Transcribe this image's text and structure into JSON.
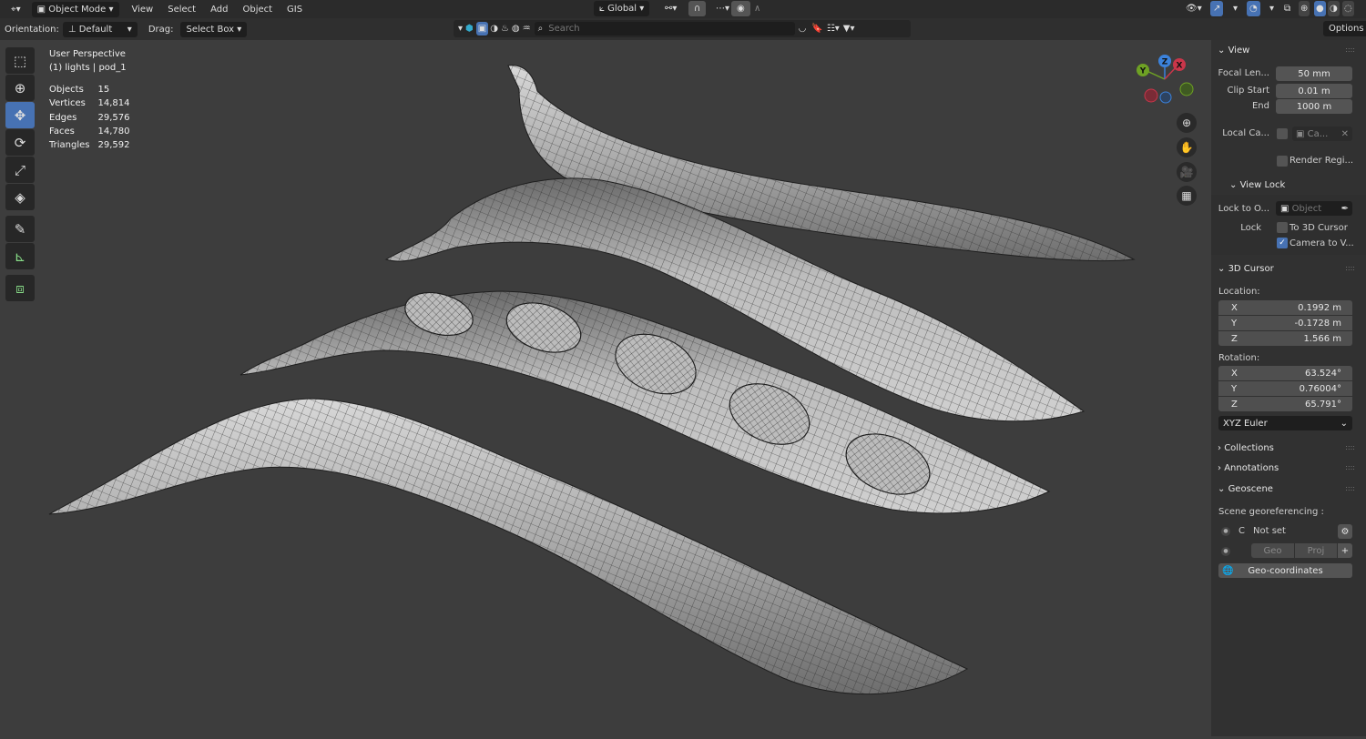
{
  "header": {
    "editor_icon": "editor-type-icon",
    "mode": "Object Mode",
    "menus": [
      "View",
      "Select",
      "Add",
      "Object",
      "GIS"
    ],
    "transform_orientation": "Global",
    "right_icons": [
      "visibility-icon",
      "gizmo-icon",
      "overlay-icon",
      "xray-icon",
      "wireframe-shading",
      "solid-shading",
      "material-shading",
      "rendered-shading"
    ]
  },
  "toolbar2": {
    "orientation_label": "Orientation:",
    "orientation_value": "Default",
    "drag_label": "Drag:",
    "drag_value": "Select Box",
    "search_placeholder": "Search",
    "options": "Options"
  },
  "viewport": {
    "view_name": "User Perspective",
    "context": "(1) lights | pod_1",
    "stats": [
      {
        "label": "Objects",
        "value": "15"
      },
      {
        "label": "Vertices",
        "value": "14,814"
      },
      {
        "label": "Edges",
        "value": "29,576"
      },
      {
        "label": "Faces",
        "value": "14,780"
      },
      {
        "label": "Triangles",
        "value": "29,592"
      }
    ],
    "axes": {
      "x": "X",
      "y": "Y",
      "z": "Z",
      "x_color": "#c9364a",
      "y_color": "#6ea124",
      "z_color": "#3b82dc"
    },
    "tools": [
      "select-box",
      "cursor",
      "move",
      "rotate",
      "scale",
      "transform",
      "annotate",
      "measure",
      "add-cube"
    ],
    "active_tool": "move"
  },
  "panel": {
    "view": {
      "title": "View",
      "focal_label": "Focal Len...",
      "focal": "50 mm",
      "clip_start_label": "Clip Start",
      "clip_start": "0.01 m",
      "end_label": "End",
      "end": "1000 m",
      "local_cam_label": "Local Ca...",
      "local_cam_value": "Ca...",
      "render_region": "Render Regi..."
    },
    "view_lock": {
      "title": "View Lock",
      "lock_to_label": "Lock to O...",
      "lock_to_placeholder": "Object",
      "lock_label": "Lock",
      "to_cursor": "To 3D Cursor",
      "camera_to_view": "Camera to V...",
      "to_cursor_checked": false,
      "camera_to_view_checked": true
    },
    "cursor": {
      "title": "3D Cursor",
      "location_label": "Location:",
      "location": [
        {
          "axis": "X",
          "value": "0.1992 m"
        },
        {
          "axis": "Y",
          "value": "-0.1728 m"
        },
        {
          "axis": "Z",
          "value": "1.566 m"
        }
      ],
      "rotation_label": "Rotation:",
      "rotation": [
        {
          "axis": "X",
          "value": "63.524°"
        },
        {
          "axis": "Y",
          "value": "0.76004°"
        },
        {
          "axis": "Z",
          "value": "65.791°"
        }
      ],
      "rotation_mode": "XYZ Euler"
    },
    "collections": "Collections",
    "annotations": "Annotations",
    "geoscene": {
      "title": "Geoscene",
      "georef_label": "Scene georeferencing :",
      "crs_letter": "C",
      "crs_value": "Not set",
      "geo": "Geo",
      "proj": "Proj",
      "geo_coords": "Geo-coordinates"
    }
  }
}
